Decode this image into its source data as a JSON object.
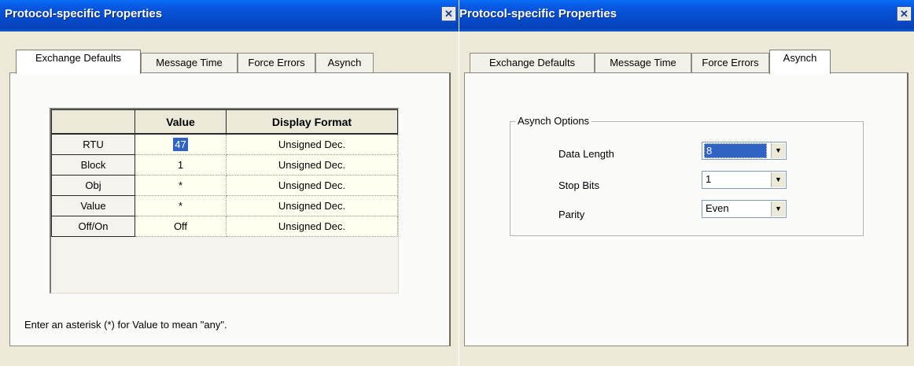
{
  "left_window": {
    "title": "Protocol-specific Properties",
    "close_glyph": "✕",
    "tabs": [
      {
        "label": "Exchange Defaults",
        "active": true
      },
      {
        "label": "Message Time",
        "active": false
      },
      {
        "label": "Force Errors",
        "active": false
      },
      {
        "label": "Asynch",
        "active": false
      }
    ],
    "grid": {
      "headers": [
        "",
        "Value",
        "Display Format"
      ],
      "rows": [
        {
          "name": "RTU",
          "value": "47",
          "format": "Unsigned Dec."
        },
        {
          "name": "Block",
          "value": "1",
          "format": "Unsigned Dec."
        },
        {
          "name": "Obj",
          "value": "*",
          "format": "Unsigned Dec."
        },
        {
          "name": "Value",
          "value": "*",
          "format": "Unsigned Dec."
        },
        {
          "name": "Off/On",
          "value": "Off",
          "format": "Unsigned Dec."
        }
      ]
    },
    "hint": "Enter an asterisk (*) for Value to mean \"any\"."
  },
  "right_window": {
    "title": "Protocol-specific Properties",
    "close_glyph": "✕",
    "tabs": [
      {
        "label": "Exchange Defaults",
        "active": false
      },
      {
        "label": "Message Time",
        "active": false
      },
      {
        "label": "Force Errors",
        "active": false
      },
      {
        "label": "Asynch",
        "active": true
      }
    ],
    "asynch_options": {
      "group_label": "Asynch Options",
      "data_length": {
        "label": "Data Length",
        "value": "8"
      },
      "stop_bits": {
        "label": "Stop Bits",
        "value": "1"
      },
      "parity": {
        "label": "Parity",
        "value": "Even"
      }
    }
  },
  "icons": {
    "dropdown": "dropdown-arrow-icon",
    "close": "close-icon"
  },
  "colors": {
    "titlebar": "#0855dd",
    "selection": "#3163c5",
    "window_bg": "#ece9d8"
  }
}
